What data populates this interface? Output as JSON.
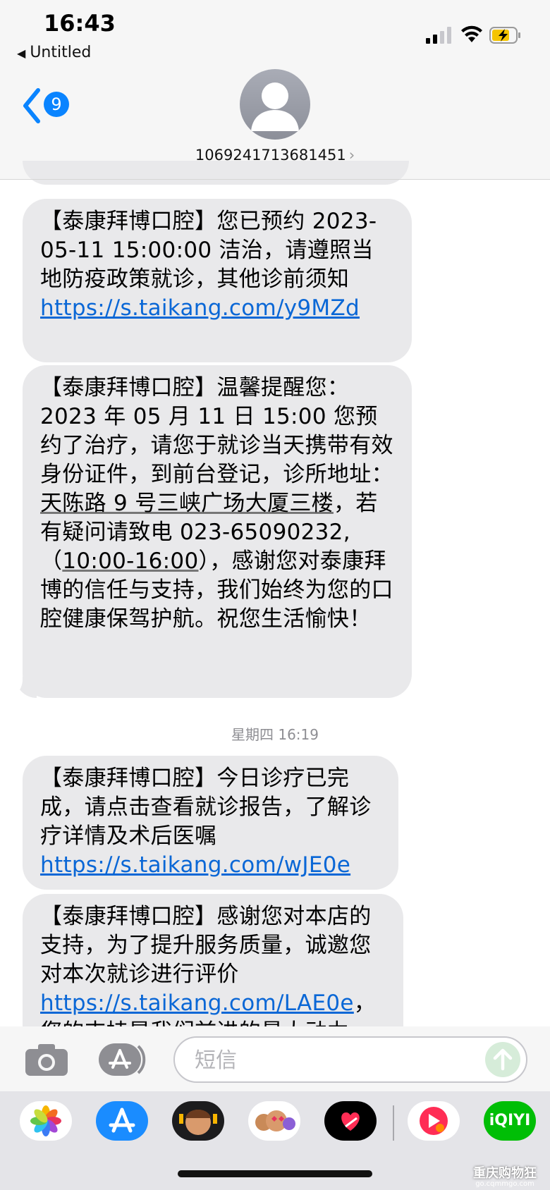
{
  "status": {
    "time": "16:43",
    "back_app": "Untitled"
  },
  "header": {
    "back_badge": "9",
    "contact": "1069241713681451"
  },
  "messages": [
    {
      "parts": [
        "【泰康拜博口腔】您已预约 2023-05-11 15:00:00 洁治，请遵照当地防疫政策就诊，其他诊前须知 ",
        "https://s.taikang.com/y9MZd"
      ]
    },
    {
      "parts": [
        "【泰康拜博口腔】温馨提醒您：2023 年 05 月 11 日 15:00 您预约了治疗，请您于就诊当天携带有效身份证件，到前台登记，诊所地址：",
        "天陈路 9 号三峡广场大厦三楼",
        "，若有疑问请致电 023-65090232, （",
        "10:00-16:00",
        "），感谢您对泰康拜博的信任与支持，我们始终为您的口腔健康保驾护航。祝您生活愉快！"
      ]
    },
    {
      "parts": [
        "【泰康拜博口腔】今日诊疗已完成，请点击查看就诊报告，了解诊疗详情及术后医嘱 ",
        "https://s.taikang.com/wJE0e"
      ]
    },
    {
      "parts": [
        "【泰康拜博口腔】感谢您对本店的支持，为了提升服务质量，诚邀您对本次就诊进行评价 ",
        "https://s.taikang.com/LAE0e",
        "，您的支持是我们前进的最大动力，谢谢！"
      ]
    }
  ],
  "timestamp": "星期四 16:19",
  "input": {
    "placeholder": "短信"
  },
  "drawer": {
    "apps": [
      "photos-app-icon",
      "app-store-icon",
      "memoji-icon",
      "animoji-icon",
      "digital-touch-icon",
      "music-app-icon",
      "iqiyi-app-icon"
    ],
    "iqiyi_label": "iQIYI"
  },
  "watermark": {
    "line1": "重庆购物狂",
    "line2": "go.cqmmgo.com"
  },
  "colors": {
    "link": "#0a67d6",
    "bubble": "#e9e9eb",
    "badge": "#0a84ff"
  }
}
